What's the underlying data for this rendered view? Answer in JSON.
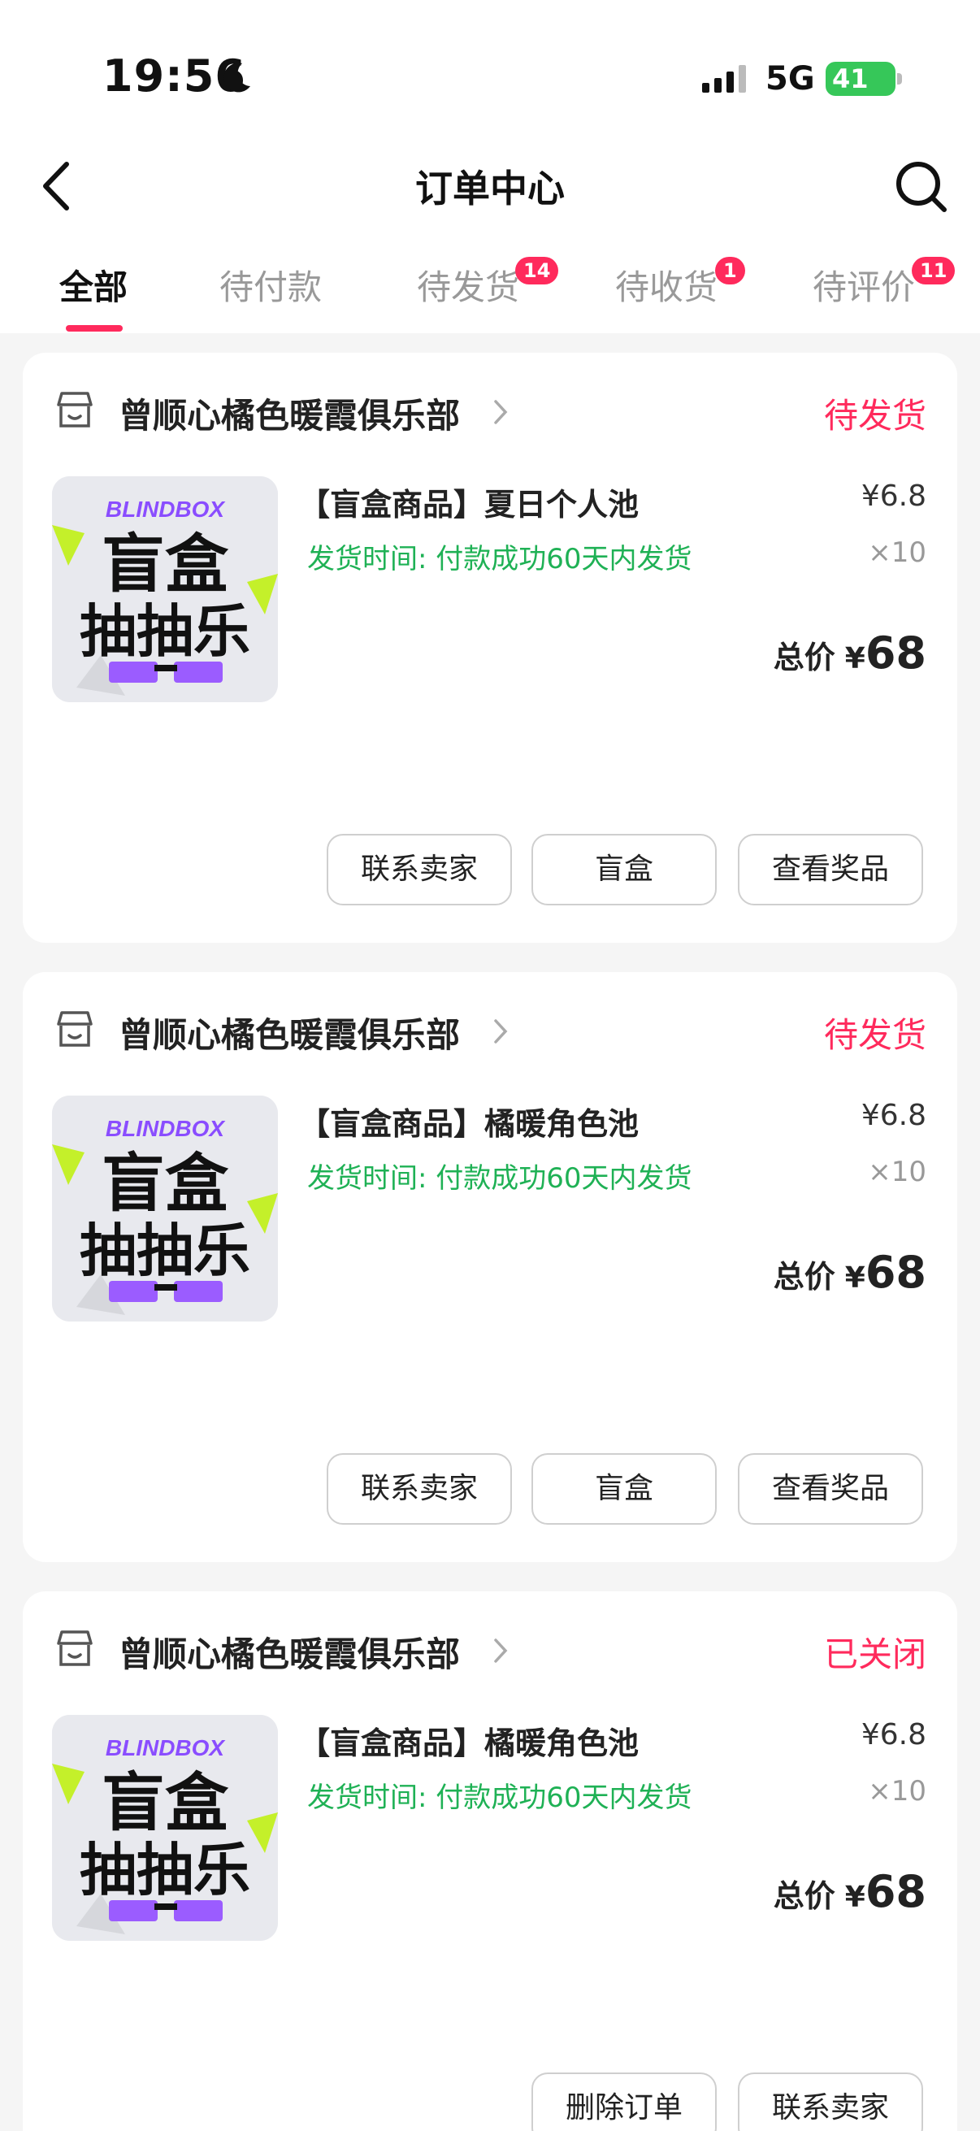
{
  "status_bar": {
    "time": "19:56",
    "network": "5G",
    "battery": "41"
  },
  "nav": {
    "title": "订单中心"
  },
  "tabs": [
    {
      "label": "全部",
      "active": true,
      "badge": ""
    },
    {
      "label": "待付款",
      "active": false,
      "badge": ""
    },
    {
      "label": "待发货",
      "active": false,
      "badge": "14"
    },
    {
      "label": "待收货",
      "active": false,
      "badge": "1"
    },
    {
      "label": "待评价",
      "active": false,
      "badge": "11"
    }
  ],
  "orders": [
    {
      "shop": "曾顺心橘色暖霞俱乐部",
      "status": "待发货",
      "product": "【盲盒商品】夏日个人池",
      "ship_note": "发货时间: 付款成功60天内发货",
      "price": "¥6.8",
      "qty": "×10",
      "total_label": "总价",
      "currency": "¥",
      "total": "68",
      "thumb": {
        "brand": "BLINDBOX",
        "line1": "盲盒",
        "line2": "抽抽乐"
      },
      "buttons": [
        "联系卖家",
        "盲盒",
        "查看奖品"
      ]
    },
    {
      "shop": "曾顺心橘色暖霞俱乐部",
      "status": "待发货",
      "product": "【盲盒商品】橘暖角色池",
      "ship_note": "发货时间: 付款成功60天内发货",
      "price": "¥6.8",
      "qty": "×10",
      "total_label": "总价",
      "currency": "¥",
      "total": "68",
      "thumb": {
        "brand": "BLINDBOX",
        "line1": "盲盒",
        "line2": "抽抽乐"
      },
      "buttons": [
        "联系卖家",
        "盲盒",
        "查看奖品"
      ]
    },
    {
      "shop": "曾顺心橘色暖霞俱乐部",
      "status": "已关闭",
      "product": "【盲盒商品】橘暖角色池",
      "ship_note": "发货时间: 付款成功60天内发货",
      "price": "¥6.8",
      "qty": "×10",
      "total_label": "总价",
      "currency": "¥",
      "total": "68",
      "thumb": {
        "brand": "BLINDBOX",
        "line1": "盲盒",
        "line2": "抽抽乐"
      },
      "buttons": [
        "删除订单",
        "联系卖家"
      ]
    }
  ],
  "colors": {
    "accent": "#ff2a5c",
    "ship_green": "#1fb155",
    "battery_green": "#36c759"
  }
}
